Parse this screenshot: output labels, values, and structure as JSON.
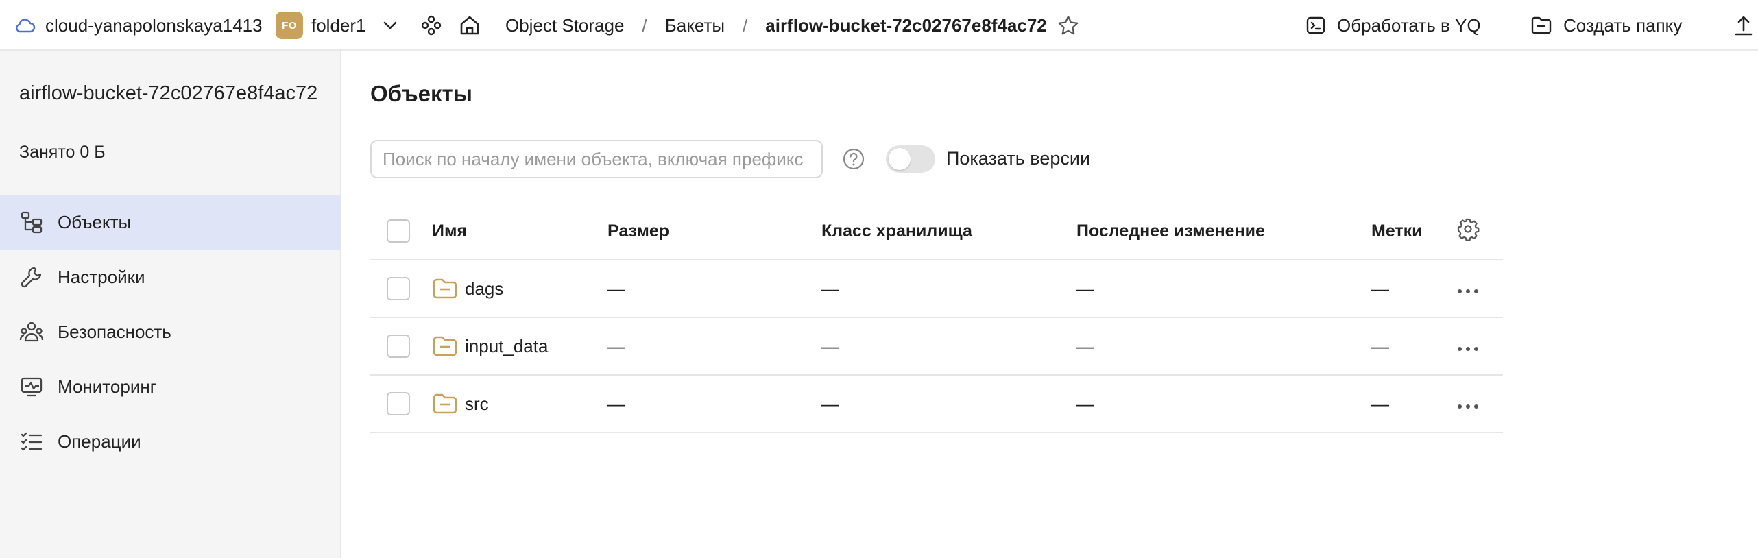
{
  "header": {
    "cloud": "cloud-yanapolonskaya1413",
    "folder_badge": "FO",
    "folder": "folder1",
    "breadcrumb": [
      "Object Storage",
      "Бакеты",
      "airflow-bucket-72c02767e8f4ac72"
    ],
    "separator": "/",
    "actions": {
      "yq": "Обработать в YQ",
      "create_folder": "Создать папку"
    }
  },
  "sidebar": {
    "bucket_name": "airflow-bucket-72c02767e8f4ac72",
    "used": "Занято 0 Б",
    "items": [
      {
        "label": "Объекты",
        "icon": "objects-icon",
        "active": true
      },
      {
        "label": "Настройки",
        "icon": "wrench-icon",
        "active": false
      },
      {
        "label": "Безопасность",
        "icon": "users-icon",
        "active": false
      },
      {
        "label": "Мониторинг",
        "icon": "monitor-icon",
        "active": false
      },
      {
        "label": "Операции",
        "icon": "list-icon",
        "active": false
      }
    ]
  },
  "main": {
    "title": "Объекты",
    "search_placeholder": "Поиск по началу имени объекта, включая префикс",
    "show_versions": "Показать версии",
    "show_versions_on": false,
    "columns": {
      "name": "Имя",
      "size": "Размер",
      "storage_class": "Класс хранилища",
      "modified": "Последнее изменение",
      "tags": "Метки"
    },
    "rows": [
      {
        "name": "dags",
        "size": "—",
        "storage_class": "—",
        "modified": "—",
        "tags": "—"
      },
      {
        "name": "input_data",
        "size": "—",
        "storage_class": "—",
        "modified": "—",
        "tags": "—"
      },
      {
        "name": "src",
        "size": "—",
        "storage_class": "—",
        "modified": "—",
        "tags": "—"
      }
    ]
  },
  "colors": {
    "accent_folder": "#c8a25c",
    "active_nav": "#dfe4f6",
    "cloud_icon": "#4f6fd6"
  }
}
